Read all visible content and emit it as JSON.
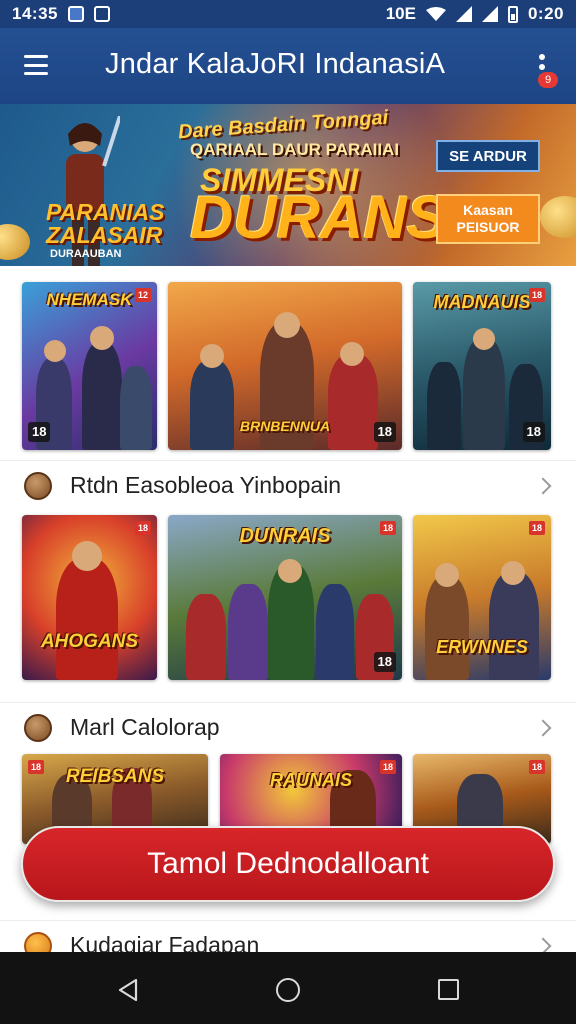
{
  "status_bar": {
    "time": "14:35",
    "right_text": "10E",
    "clock_right": "0:20",
    "icons": [
      "gallery-icon",
      "camera-icon",
      "wifi-icon",
      "signal-icon",
      "signal-icon",
      "battery-icon"
    ]
  },
  "app_bar": {
    "title": "Jndar KalaJoRI  IndanasiA",
    "badge": "9"
  },
  "banner": {
    "top_line": "Dare Basdain Tonngai",
    "sub_line": "QARIAAL  DAUR  PARAIIAI",
    "mid_line": "SIMMESNI",
    "big_line": "DURANS",
    "logo_line1": "PARANIAS",
    "logo_line2": "ZALASAIR",
    "logo_caption": "DURAAUBAN",
    "btn_blue": "SE ARDUR",
    "btn_orange_line1": "Kaasan",
    "btn_orange_line2": "PEISUOR"
  },
  "grid_rows": [
    {
      "cards": [
        {
          "title": "NHEMASK",
          "corner": "12",
          "tag": "18",
          "tag_side": "left",
          "palette": [
            "#2a2e6a",
            "#6a3aa2",
            "#3aa0d8"
          ]
        },
        {
          "title": "BRNBENNUA",
          "corner": "",
          "tag": "18",
          "tag_side": "right",
          "palette": [
            "#5a2a2a",
            "#d26a2a",
            "#f2a84a"
          ]
        },
        {
          "title": "MADNAUIS",
          "corner": "18",
          "tag": "18",
          "tag_side": "right",
          "palette": [
            "#0f2a3a",
            "#2a5a6a",
            "#5a9aa8"
          ]
        }
      ]
    },
    {
      "cards": [
        {
          "title": "AHOGANS",
          "corner": "18",
          "tag": "",
          "tag_side": "right",
          "palette": [
            "#3a1a4a",
            "#d8402a",
            "#f2b23a"
          ]
        },
        {
          "title": "DUNRAIS",
          "corner": "18",
          "tag": "18",
          "tag_side": "right",
          "palette": [
            "#1e3a4a",
            "#5a7a3a",
            "#8aa8c8"
          ]
        },
        {
          "title": "ERWNNES",
          "corner": "18",
          "tag": "",
          "tag_side": "right",
          "palette": [
            "#2a3a6a",
            "#c87a2a",
            "#f2c84a"
          ]
        }
      ]
    },
    {
      "cards": [
        {
          "title": "REIBSANS",
          "corner": "18",
          "tag": "",
          "tag_side": "right",
          "palette": [
            "#3a2a1a",
            "#8a5a2a",
            "#d8a84a"
          ]
        },
        {
          "title": "RAUNAIS",
          "corner": "18",
          "tag": "",
          "tag_side": "right",
          "palette": [
            "#2a1a5a",
            "#c83a6a",
            "#f2c83a"
          ]
        },
        {
          "title": "",
          "corner": "18",
          "tag": "",
          "tag_side": "right",
          "palette": [
            "#3a2a1a",
            "#a85a1a",
            "#e8b86a"
          ]
        }
      ]
    }
  ],
  "sections": [
    {
      "label": "Rtdn Easobleoa Yinbopain"
    },
    {
      "label": "Marl Calolorap"
    },
    {
      "label": "Kudagiar Fadapan"
    }
  ],
  "download_button": {
    "label": "Tamol Dednodalloant"
  },
  "nav": {
    "icons": [
      "back-icon",
      "home-icon",
      "recent-apps-icon"
    ]
  }
}
